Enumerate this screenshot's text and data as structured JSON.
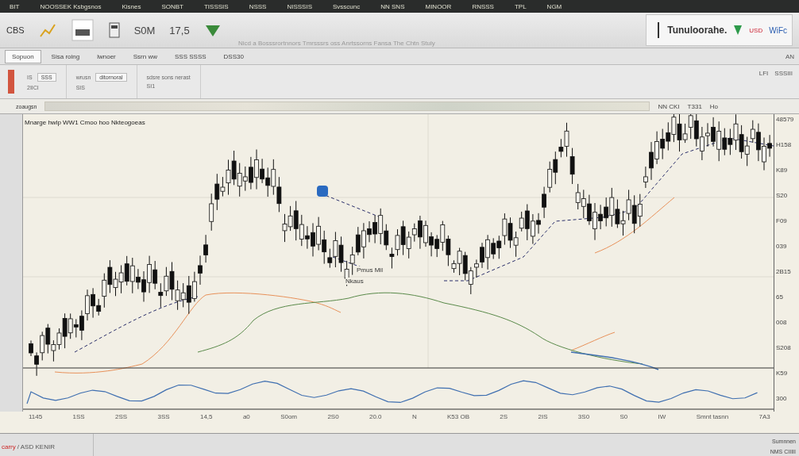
{
  "ticker_bar": {
    "items": [
      "BIT",
      "NOOSSEK Ksbgsnos",
      "Kisnes",
      "SONBT",
      "TISSSIS",
      "NSSS",
      "NISSSIS",
      "Svsscunc",
      "NN SNS",
      "MINOOR",
      "RNSSS",
      "TPL",
      "NGM"
    ]
  },
  "toolbar": {
    "brand": "CBS",
    "items": [
      {
        "label": "S0M"
      },
      {
        "label": "17,5"
      }
    ],
    "caption": "Nicd a Bosssrortnnors Tmrsssrs oss Anrtssorns Fansa The Chtn Stuly",
    "account": {
      "name": "Tunuloorahe.",
      "currency": "USD",
      "suffix": "WiFc"
    }
  },
  "tabs": [
    {
      "label": "Sopuon",
      "selected": true
    },
    {
      "label": "Sisa roing",
      "selected": false
    },
    {
      "label": "lwnoer",
      "selected": false
    },
    {
      "label": "Ssrn ww",
      "selected": false
    },
    {
      "label": "SSS SSSS",
      "selected": false
    },
    {
      "label": "DSS30",
      "selected": false
    }
  ],
  "tab_bar_end": "AN",
  "order_panel": {
    "fields": [
      {
        "label": "IS",
        "value": "SSS",
        "sub": "2IICI"
      },
      {
        "label": "wrusn",
        "value": "ditornoral",
        "sub": "SIS"
      }
    ],
    "note": "sdsre sons nerast",
    "note_sub": "SI1",
    "right": [
      "LFI",
      "SSSIII"
    ]
  },
  "overview": {
    "label": "zoaugsn",
    "stats": [
      "NN CKI",
      "T331",
      "Ho"
    ]
  },
  "chart": {
    "title": "Mnarge hwlp WW1 Cmoo hoo Nkteogoeas",
    "annotations": [
      "Pmus Mil",
      "Nkaus"
    ],
    "y_labels": [
      "48579",
      "H158",
      "K89",
      "S20",
      "F09",
      "039",
      "2B15",
      "65",
      "008",
      "S208",
      "K59",
      "300"
    ],
    "x_labels": [
      "1145",
      "1SS",
      "2SS",
      "3SS",
      "14,5",
      "a0",
      "S0om",
      "2S0",
      "20.0",
      "N",
      "K53 OB",
      "2S",
      "2IS",
      "3S0",
      "S0",
      "IW",
      "Smnt tasnn",
      "7A3"
    ]
  },
  "status_bar": {
    "brand": "carry",
    "text": "/ ASD KENIR",
    "right": [
      "Sumnnen",
      "NMS CIIIII"
    ]
  }
}
